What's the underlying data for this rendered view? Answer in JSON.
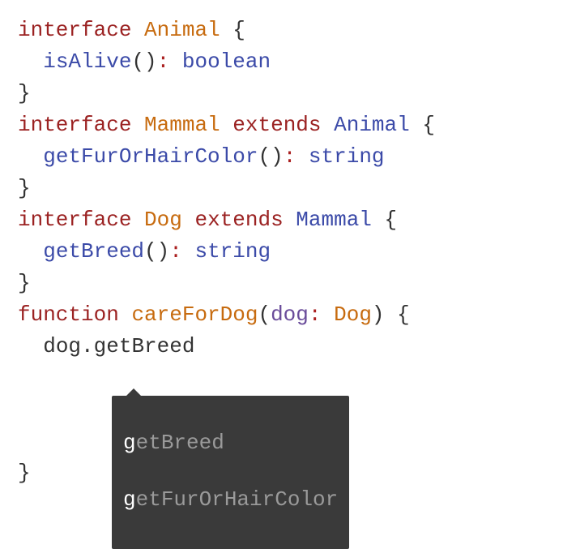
{
  "code": {
    "kw_interface": "interface",
    "kw_extends": "extends",
    "kw_function": "function",
    "t_animal": "Animal",
    "t_mammal": "Mammal",
    "t_dog": "Dog",
    "m_isAlive": "isAlive",
    "r_boolean": "boolean",
    "m_getFurOrHairColor": "getFurOrHairColor",
    "r_string": "string",
    "m_getBreed": "getBreed",
    "fn_careForDog": "careForDog",
    "p_dog": "dog",
    "call_obj": "dog",
    "call_dot": ".",
    "call_member": "getBreed",
    "open_brace": "{",
    "close_brace": "}",
    "open_paren": "(",
    "close_paren": ")",
    "colon": ":",
    "colon2": ": "
  },
  "autocomplete": {
    "items": [
      {
        "match": "g",
        "rest": "etBreed"
      },
      {
        "match": "g",
        "rest": "etFurOrHairColor"
      }
    ]
  }
}
